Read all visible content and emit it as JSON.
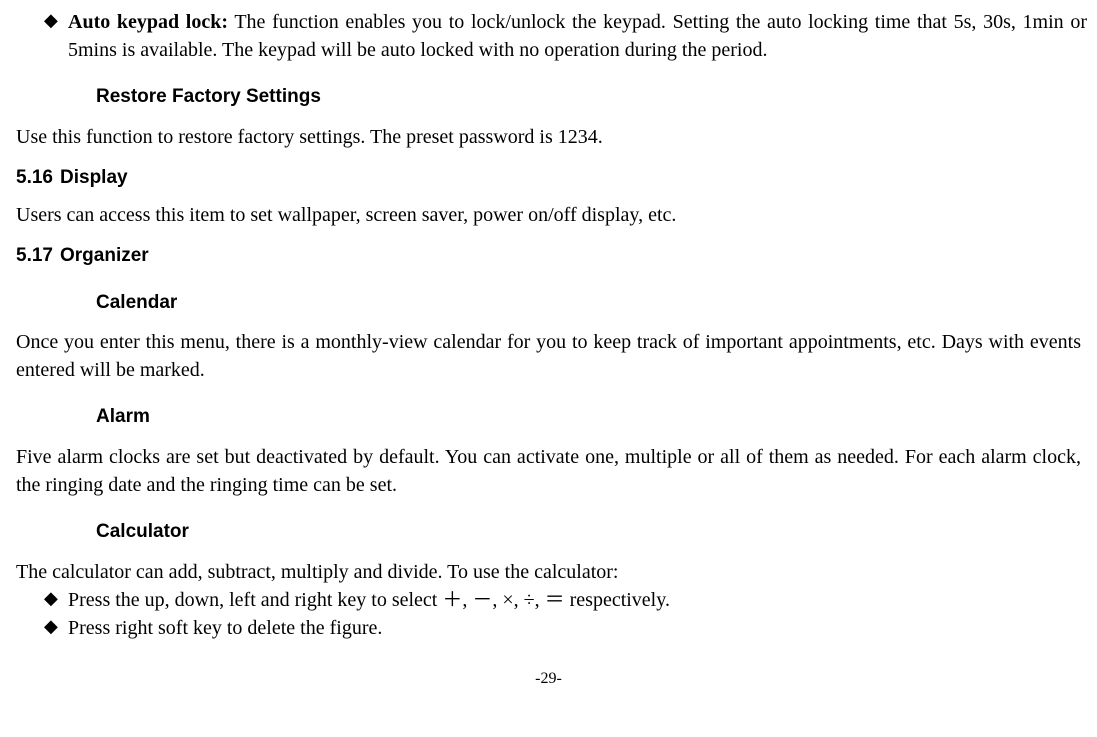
{
  "bullet1": {
    "title": "Auto keypad lock:",
    "text": " The function enables you to lock/unlock the keypad. Setting the auto locking time that 5s, 30s, 1min or 5mins is available. The keypad will be auto locked with no operation during the period."
  },
  "headings": {
    "restore": "Restore Factory Settings",
    "display_num": "5.16",
    "display": "Display",
    "organizer_num": "5.17",
    "organizer": "Organizer",
    "calendar": "Calendar",
    "alarm": "Alarm",
    "calculator": "Calculator"
  },
  "paragraphs": {
    "restore": "Use this function to restore factory settings. The preset password is 1234.",
    "display": "Users can access this item to set wallpaper, screen saver, power on/off display, etc.",
    "calendar": "Once you enter this menu, there is a monthly-view calendar for you to keep track of important appointments, etc. Days with events entered will be marked.",
    "alarm": "Five alarm clocks are set but deactivated by default. You can activate one, multiple or all of them as needed. For each alarm clock, the ringing date and the ringing time can be set.",
    "calculator_intro": "The calculator can add, subtract, multiply and divide. To use the calculator:"
  },
  "calc_bullets": {
    "b1": "Press the up, down, left and right key to select ＋, －, ×, ÷, ＝ respectively.",
    "b2": "Press right soft key to delete the figure."
  },
  "page_number": "-29-"
}
